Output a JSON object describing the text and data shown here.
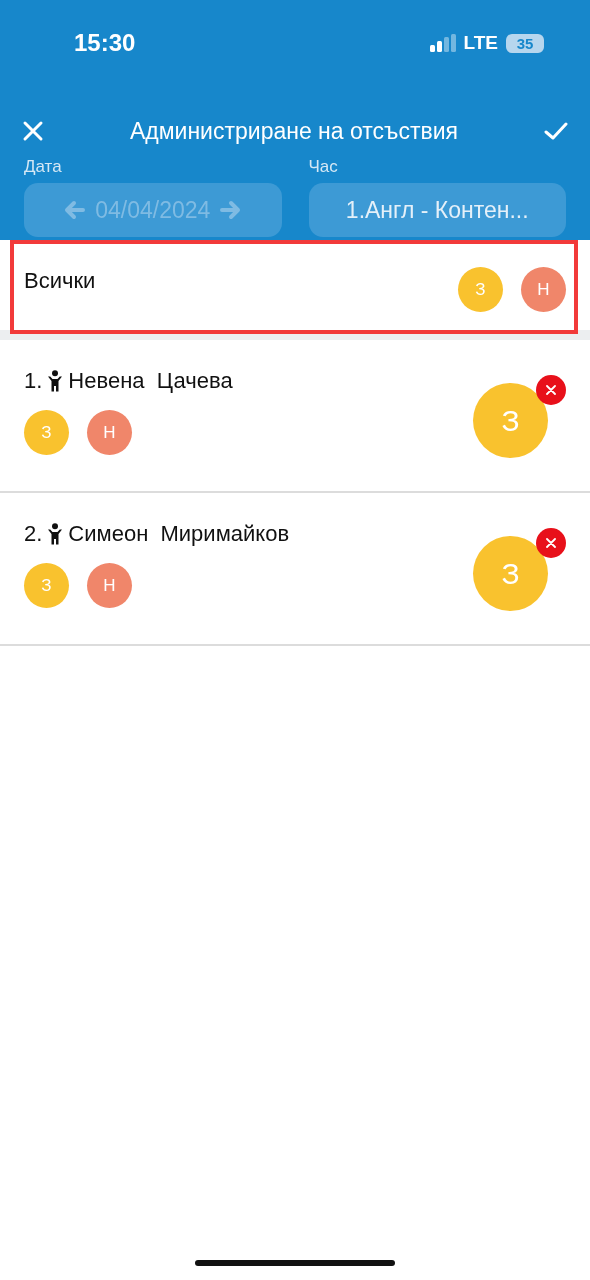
{
  "status_bar": {
    "time": "15:30",
    "network": "LTE",
    "battery": "35"
  },
  "header": {
    "title": "Администриране на отсъствия",
    "date_label": "Дата",
    "date": "04/04/2024",
    "date_disabled": true,
    "hour_label": "Час",
    "hour": "1.Англ - Контен..."
  },
  "all_row": {
    "label": "Всички",
    "highlighted": true,
    "codes": [
      {
        "label": "З",
        "color": "#f9c22e"
      },
      {
        "label": "Н",
        "color": "#f0866a"
      }
    ]
  },
  "students": [
    {
      "number": "1.",
      "name": "Невена  Цачева",
      "codes": [
        {
          "label": "З",
          "color": "#f9c22e"
        },
        {
          "label": "Н",
          "color": "#f0866a"
        }
      ],
      "assigned": {
        "label": "З",
        "color": "#f9c22e"
      }
    },
    {
      "number": "2.",
      "name": "Симеон  Миримайков",
      "codes": [
        {
          "label": "З",
          "color": "#f9c22e"
        },
        {
          "label": "Н",
          "color": "#f0866a"
        }
      ],
      "assigned": {
        "label": "З",
        "color": "#f9c22e"
      }
    }
  ]
}
